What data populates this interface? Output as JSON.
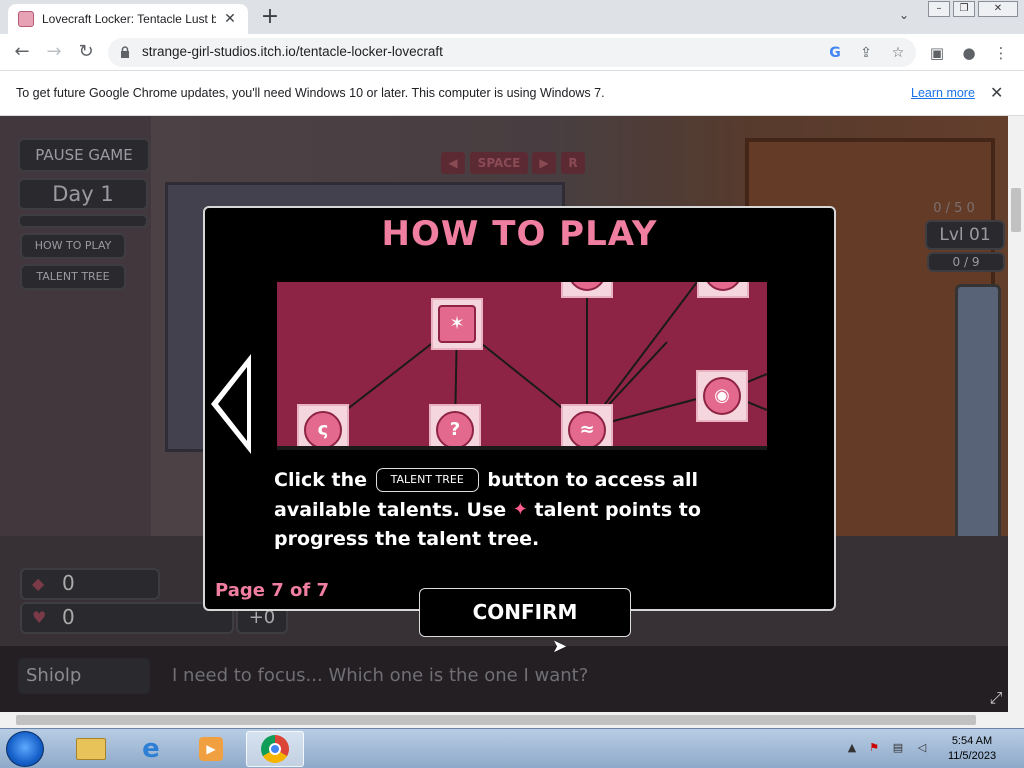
{
  "browser": {
    "tab_title": "Lovecraft Locker: Tentacle Lust b",
    "url": "strange-girl-studios.itch.io/tentacle-locker-lovecraft"
  },
  "infobar": {
    "message": "To get future Google Chrome updates, you'll need Windows 10 or later. This computer is using Windows 7.",
    "learn_more": "Learn more"
  },
  "hud": {
    "pause": "PAUSE GAME",
    "day": "Day 1",
    "how_to_play": "HOW TO PLAY",
    "talent_tree": "TALENT TREE",
    "keys": [
      "SPACE",
      "R"
    ],
    "counter": "0 / 5 0",
    "level": "Lvl 01",
    "sub_counter": "0 / 9",
    "stat_1": "0",
    "stat_2": "0",
    "bonus": "+0"
  },
  "dialog": {
    "speaker": "Shiolp",
    "text": "I need to focus... Which one is the one I want?"
  },
  "modal": {
    "title": "HOW TO PLAY",
    "text_1": "Click the",
    "chip": "TALENT TREE",
    "text_2": "button to access all available talents. Use",
    "text_3": "talent points to progress the talent tree.",
    "page": "Page 7 of 7",
    "confirm": "CONFIRM"
  },
  "taskbar": {
    "time": "5:54 AM",
    "date": "11/5/2023"
  }
}
